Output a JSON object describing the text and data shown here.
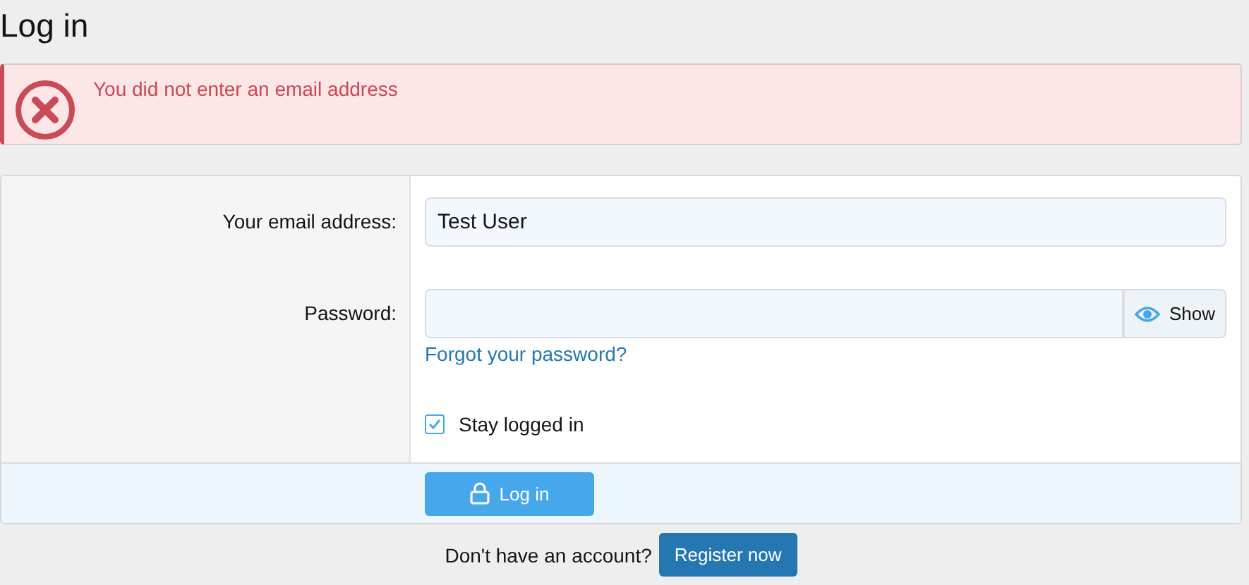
{
  "title": "Log in",
  "error": {
    "message": "You did not enter an email address"
  },
  "form": {
    "email": {
      "label": "Your email address:",
      "value": "Test User"
    },
    "password": {
      "label": "Password:",
      "toggle": "Show",
      "forgot_link": "Forgot your password?"
    },
    "stay_logged_in": {
      "label": "Stay logged in",
      "checked": true
    },
    "submit": "Log in"
  },
  "register": {
    "prompt": "Don't have an account?",
    "button": "Register now"
  }
}
